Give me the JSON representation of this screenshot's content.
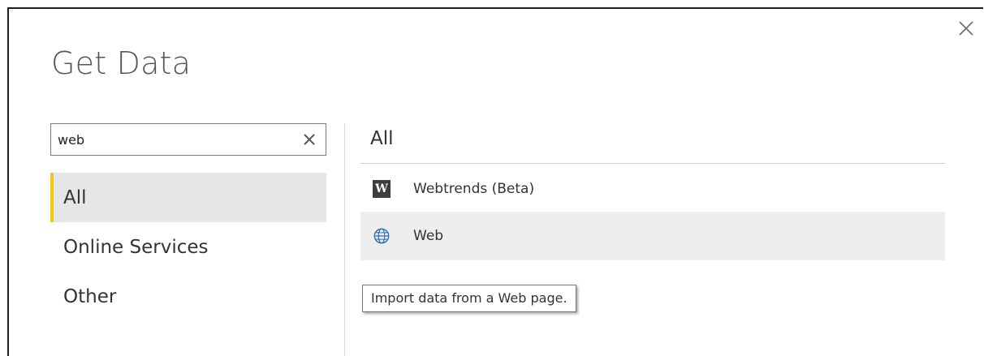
{
  "dialog": {
    "title": "Get Data",
    "close_icon": "close-icon"
  },
  "search": {
    "value": "web",
    "clear_icon": "clear-x-icon"
  },
  "categories": {
    "items": [
      {
        "label": "All",
        "selected": true
      },
      {
        "label": "Online Services",
        "selected": false
      },
      {
        "label": "Other",
        "selected": false
      }
    ]
  },
  "results": {
    "header": "All",
    "items": [
      {
        "label": "Webtrends (Beta)",
        "icon": "webtrends-icon",
        "icon_glyph": "W"
      },
      {
        "label": "Web",
        "icon": "globe-icon"
      }
    ],
    "tooltip": "Import data from a Web page."
  },
  "colors": {
    "selected_accent": "#f2c811",
    "selected_bg": "#e6e6e6",
    "hover_bg": "#eeeeee",
    "globe_blue": "#2b6cb0"
  }
}
